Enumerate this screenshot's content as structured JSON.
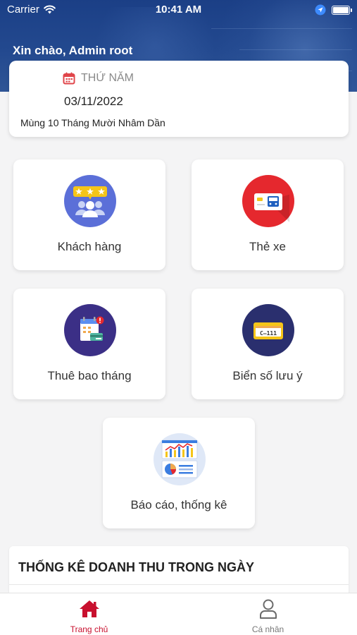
{
  "status_bar": {
    "carrier": "Carrier",
    "time": "10:41 AM"
  },
  "header": {
    "greeting": "Xin chào, Admin root"
  },
  "date_card": {
    "weekday": "THỨ NĂM",
    "date": "03/11/2022",
    "lunar": "Mùng 10 Tháng Mười Nhâm Dần",
    "calendar_icon_color": "#e0454a"
  },
  "menu": [
    {
      "id": "customers",
      "label": "Khách hàng",
      "icon": "customers-rating-icon",
      "bg": "#5b6fd8"
    },
    {
      "id": "vehicle-card",
      "label": "Thẻ xe",
      "icon": "bus-card-icon",
      "bg": "#e5282e"
    },
    {
      "id": "monthly-subscription",
      "label": "Thuê bao tháng",
      "icon": "monthly-calendar-icon",
      "bg": "#3b2f86"
    },
    {
      "id": "watch-plates",
      "label": "Biển số lưu ý",
      "icon": "license-plate-icon",
      "bg": "#2a2f6e"
    },
    {
      "id": "reports",
      "label": "Báo cáo, thống kê",
      "icon": "report-chart-icon",
      "bg": "#dfe8f7"
    }
  ],
  "revenue": {
    "title": "THỐNG KÊ DOANH THU TRONG NGÀY"
  },
  "tabbar": {
    "home_label": "Trang chủ",
    "profile_label": "Cá nhân",
    "active_color": "#c8102e",
    "inactive_color": "#777777"
  }
}
